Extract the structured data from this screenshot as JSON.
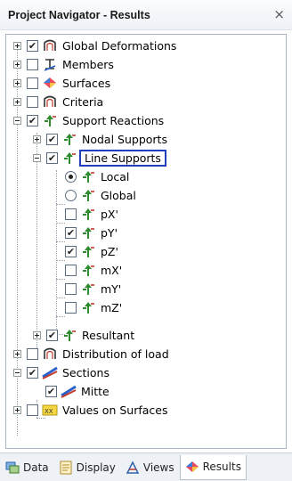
{
  "window": {
    "title": "Project Navigator - Results",
    "close_glyph": "×"
  },
  "tree": {
    "global_deformations": "Global Deformations",
    "members": "Members",
    "surfaces": "Surfaces",
    "criteria": "Criteria",
    "support_reactions": "Support Reactions",
    "nodal_supports": "Nodal Supports",
    "line_supports": "Line Supports",
    "local": "Local",
    "global": "Global",
    "px": "pX'",
    "py": "pY'",
    "pz": "pZ'",
    "mx": "mX'",
    "my": "mY'",
    "mz": "mZ'",
    "resultant": "Resultant",
    "distribution_of_load": "Distribution of load",
    "sections": "Sections",
    "mitte": "Mitte",
    "values_on_surfaces": "Values on Surfaces",
    "xx_badge": "XX"
  },
  "checked_glyph": "✔",
  "tabs": [
    "Data",
    "Display",
    "Views",
    "Results"
  ],
  "active_tab": "Results",
  "colors": {
    "selection_border": "#1f3fbf",
    "reaction_icon": "#2e8b2e"
  }
}
